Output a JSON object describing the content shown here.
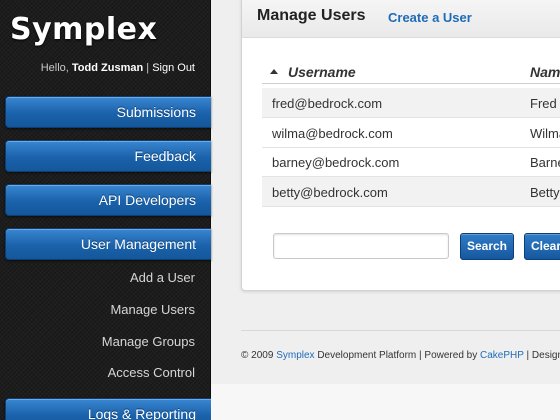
{
  "app": {
    "logo": "Symplex",
    "greeting": "Hello,",
    "username": "Todd Zusman",
    "separator": "|",
    "sign_out": "Sign Out"
  },
  "sidebar": {
    "items": [
      {
        "label": "Submissions"
      },
      {
        "label": "Feedback"
      },
      {
        "label": "API Developers"
      },
      {
        "label": "User Management"
      },
      {
        "label": "Logs & Reporting"
      }
    ],
    "subitems": [
      {
        "label": "Add a User"
      },
      {
        "label": "Manage Users"
      },
      {
        "label": "Manage Groups"
      },
      {
        "label": "Access Control"
      }
    ]
  },
  "main": {
    "title": "Manage Users",
    "create_link": "Create a User",
    "table": {
      "columns": [
        "Username",
        "Nam"
      ],
      "rows": [
        [
          "fred@bedrock.com",
          "Fred"
        ],
        [
          "wilma@bedrock.com",
          "Wilma"
        ],
        [
          "barney@bedrock.com",
          "Barney"
        ],
        [
          "betty@bedrock.com",
          "Betty"
        ]
      ]
    },
    "search": {
      "value": "",
      "placeholder": "",
      "search_label": "Search",
      "clear_label": "Clear"
    }
  },
  "footer": {
    "prefix": "© 2009",
    "brand": "Symplex",
    "middle": "Development Platform | Powered by",
    "framework": "CakePHP",
    "suffix": "| Design"
  },
  "colors": {
    "accent": "#1a62ab",
    "link": "#1e6bb8",
    "sidebar_bg": "#1d1d1d"
  }
}
